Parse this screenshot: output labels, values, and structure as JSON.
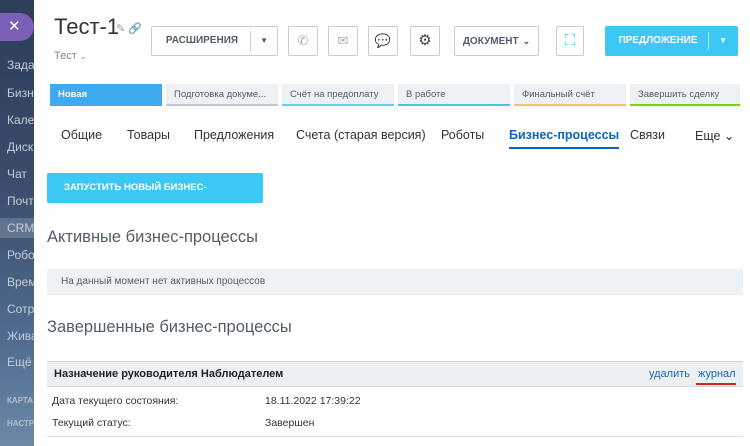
{
  "sidebar": {
    "close_glyph": "✕",
    "items": [
      {
        "label": "Задачи"
      },
      {
        "label": "Бизнес"
      },
      {
        "label": "Календарь"
      },
      {
        "label": "Диск"
      },
      {
        "label": "Чат"
      },
      {
        "label": "Почта"
      },
      {
        "label": "CRM"
      },
      {
        "label": "Роботы"
      },
      {
        "label": "Время"
      },
      {
        "label": "Сотрудники"
      },
      {
        "label": "Живая"
      },
      {
        "label": "Ещё"
      },
      {
        "label": "КАРТА"
      },
      {
        "label": "НАСТРОЙКИ"
      }
    ]
  },
  "header": {
    "title": "Тест-1",
    "title_icons": "✎ 🔗",
    "subtitle": "Тест",
    "subtitle_caret": "⌄"
  },
  "toolbar": {
    "extensions_label": "РАСШИРЕНИЯ",
    "dropdown_arrow": "▼",
    "phone_glyph": "✆",
    "mail_glyph": "✉",
    "chat_glyph": "💬",
    "settings_glyph": "⚙",
    "document_label": "ДОКУМЕНТ",
    "document_arrow": "⌄",
    "scan_glyph": "⛶",
    "offer_label": "ПРЕДЛОЖЕНИЕ"
  },
  "stages": [
    {
      "label": "Новая",
      "color": "#3eaaf0"
    },
    {
      "label": "Подготовка докуме...",
      "color": "#c3c9d0"
    },
    {
      "label": "Счёт на предоплату",
      "color": "#5fd3f3"
    },
    {
      "label": "В работе",
      "color": "#47c6e6"
    },
    {
      "label": "Финальный счёт",
      "color": "#f7c46c"
    },
    {
      "label": "Завершить сделку",
      "color": "#7bd500"
    }
  ],
  "tabs": [
    {
      "label": "Общие"
    },
    {
      "label": "Товары"
    },
    {
      "label": "Предложения"
    },
    {
      "label": "Счета (старая версия)"
    },
    {
      "label": "Роботы"
    },
    {
      "label": "Бизнес-процессы"
    },
    {
      "label": "Связи"
    },
    {
      "label": "Еще ⌄"
    }
  ],
  "run_button": {
    "label": "ЗАПУСТИТЬ НОВЫЙ БИЗНЕС-ПРОЦЕСС",
    "arrow": "⌄"
  },
  "active_section": {
    "title": "Активные бизнес-процессы",
    "empty_text": "На данный момент нет активных процессов"
  },
  "completed_section": {
    "title": "Завершенные бизнес-процессы",
    "process": {
      "name": "Назначение руководителя Наблюдателем",
      "delete_label": "удалить",
      "log_label": "журнал",
      "rows": [
        {
          "label": "Дата текущего состояния:",
          "value": "18.11.2022 17:39:22"
        },
        {
          "label": "Текущий статус:",
          "value": "Завершен"
        }
      ]
    }
  },
  "colors": {
    "accent": "#3bc8f5",
    "active_tab": "#0b66c3",
    "link": "#2067b0",
    "highlight_underline": "#e02020"
  }
}
